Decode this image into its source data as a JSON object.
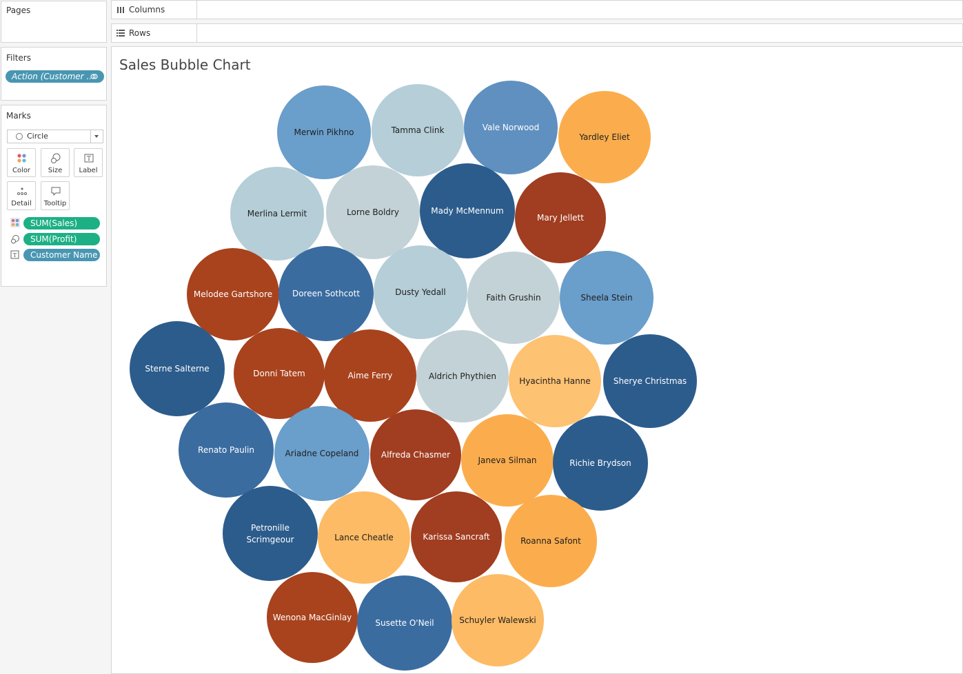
{
  "pages": {
    "title": "Pages"
  },
  "shelves": {
    "columns_label": "Columns",
    "rows_label": "Rows"
  },
  "filters": {
    "title": "Filters",
    "pill_label": "Action (Customer ..",
    "pill_color": "#4996b2"
  },
  "marks": {
    "title": "Marks",
    "mark_type": "Circle",
    "buttons": {
      "color": "Color",
      "size": "Size",
      "label": "Label",
      "detail": "Detail",
      "tooltip": "Tooltip"
    },
    "fields": [
      {
        "label": "SUM(Sales)",
        "icon": "color-icon",
        "color": "#1db085"
      },
      {
        "label": "SUM(Profit)",
        "icon": "size-icon",
        "color": "#1db085"
      },
      {
        "label": "Customer Name",
        "icon": "label-icon",
        "color": "#4996b2"
      }
    ]
  },
  "view": {
    "title": "Sales Bubble Chart"
  },
  "chart_data": {
    "type": "bubble",
    "title": "Sales Bubble Chart",
    "color_field": "SUM(Sales)",
    "size_field": "SUM(Profit)",
    "label_field": "Customer Name",
    "palette": {
      "dark_blue": "#2c5c8c",
      "blue": "#3e6fa2",
      "light_blue": "#6a9ecb",
      "pale_blue": "#b3cdd8",
      "gray_blue": "#c3d2d7",
      "rust": "#a13d20",
      "orange": "#fbad4d",
      "light_orange": "#fcbd69"
    },
    "bubbles": [
      {
        "name": "Merwin Pikhno",
        "color": "#6a9ecb"
      },
      {
        "name": "Tamma Clink",
        "color": "#b5ced8"
      },
      {
        "name": "Vale Norwood",
        "color": "#5f90c0"
      },
      {
        "name": "Yardley Eliet",
        "color": "#fbad4d"
      },
      {
        "name": "Merlina Lermit",
        "color": "#b5ced8"
      },
      {
        "name": "Lorne Boldry",
        "color": "#c3d2d7"
      },
      {
        "name": "Mady McMennum",
        "color": "#2c5c8c"
      },
      {
        "name": "Mary Jellett",
        "color": "#a13d20"
      },
      {
        "name": "Melodee Gartshore",
        "color": "#a8431e"
      },
      {
        "name": "Doreen Sothcott",
        "color": "#3a6ca0"
      },
      {
        "name": "Dusty Yedall",
        "color": "#b5ced8"
      },
      {
        "name": "Faith Grushin",
        "color": "#c3d2d7"
      },
      {
        "name": "Sheela Stein",
        "color": "#6a9ecb"
      },
      {
        "name": "Sterne Salterne",
        "color": "#2c5c8c"
      },
      {
        "name": "Donni Tatem",
        "color": "#a8431e"
      },
      {
        "name": "Aime Ferry",
        "color": "#a8431e"
      },
      {
        "name": "Aldrich Phythien",
        "color": "#c3d2d7"
      },
      {
        "name": "Hyacintha Hanne",
        "color": "#fdc272"
      },
      {
        "name": "Sherye Christmas",
        "color": "#2c5c8c"
      },
      {
        "name": "Renato Paulin",
        "color": "#3a6ca0"
      },
      {
        "name": "Ariadne Copeland",
        "color": "#6a9ecb"
      },
      {
        "name": "Alfreda Chasmer",
        "color": "#a13d20"
      },
      {
        "name": "Janeva Silman",
        "color": "#fbad4d"
      },
      {
        "name": "Richie Brydson",
        "color": "#2c5c8c"
      },
      {
        "name": "Petronille Scrimgeour",
        "color": "#2c5c8c"
      },
      {
        "name": "Lance Cheatle",
        "color": "#fdbb65"
      },
      {
        "name": "Karissa Sancraft",
        "color": "#a13d20"
      },
      {
        "name": "Roanna Safont",
        "color": "#fbad4d"
      },
      {
        "name": "Wenona MacGinlay",
        "color": "#a8431e"
      },
      {
        "name": "Susette O'Neil",
        "color": "#3a6ca0"
      },
      {
        "name": "Schuyler Walewski",
        "color": "#fdbb65"
      }
    ]
  }
}
